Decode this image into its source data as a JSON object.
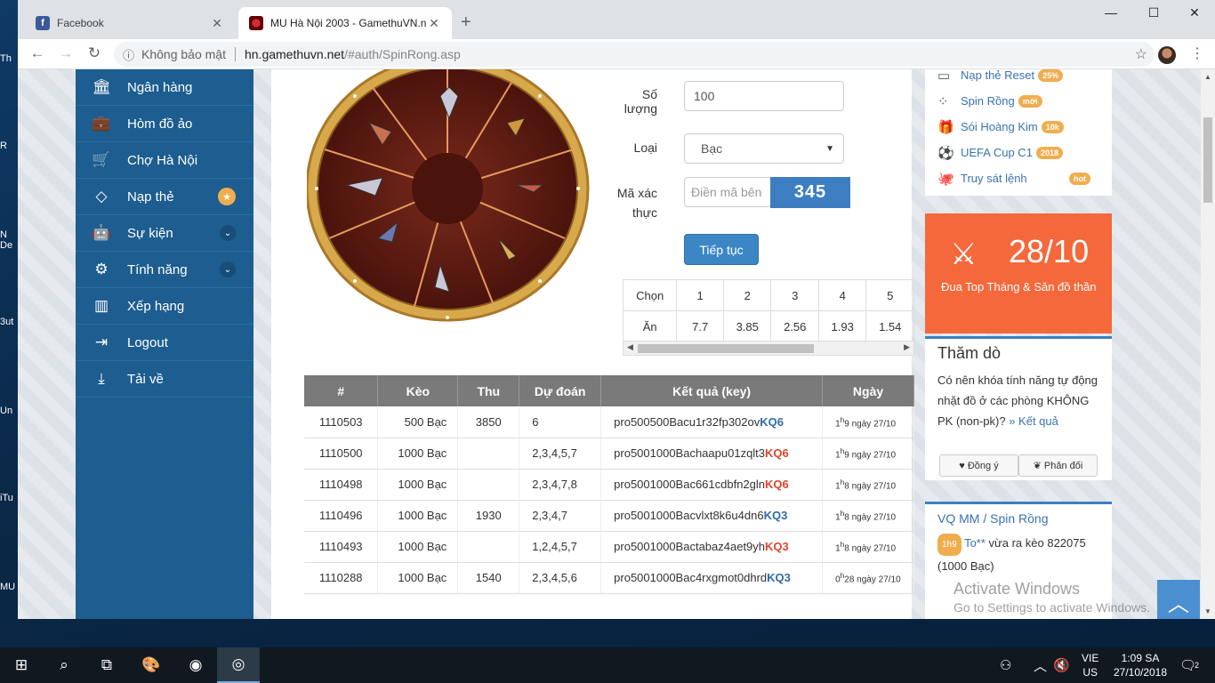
{
  "desktop": {
    "icons": [
      "Th",
      "R",
      "N\nDe",
      "3ut",
      "Un",
      "iTu",
      "MU"
    ]
  },
  "browser": {
    "tabs": [
      {
        "title": "Facebook",
        "active": false
      },
      {
        "title": "MU Hà Nội 2003 - GamethuVN.n",
        "active": true
      }
    ],
    "window_controls": {
      "minimize": "—",
      "maximize": "☐",
      "close": "✕"
    },
    "address": {
      "security_label": "Không bảo mật",
      "host": "hn.gamethuvn.net",
      "path": "/#auth/SpinRong.asp"
    }
  },
  "sidebar": {
    "items": [
      {
        "label": "Ngân hàng",
        "icon": "bank-icon"
      },
      {
        "label": "Hòm đồ ảo",
        "icon": "briefcase-icon"
      },
      {
        "label": "Chợ Hà Nội",
        "icon": "cart-icon"
      },
      {
        "label": "Nạp thẻ",
        "icon": "diamond-icon"
      },
      {
        "label": "Sự kiện",
        "icon": "android-icon"
      },
      {
        "label": "Tính năng",
        "icon": "cogs-icon"
      },
      {
        "label": "Xếp hạng",
        "icon": "bar-chart-icon"
      },
      {
        "label": "Logout",
        "icon": "logout-icon"
      },
      {
        "label": "Tải về",
        "icon": "download-icon"
      }
    ]
  },
  "form": {
    "quantity_label": "Số lượng",
    "quantity_value": "100",
    "type_label": "Loại",
    "type_value": "Bạc",
    "captcha_label_1": "Mã xác",
    "captcha_label_2": "thực",
    "captcha_placeholder": "Điền mã bên",
    "captcha_code": "345",
    "submit_label": "Tiếp tục"
  },
  "odds": {
    "choose_label": "Chọn",
    "win_label": "Ăn",
    "choices": [
      "1",
      "2",
      "3",
      "4",
      "5"
    ],
    "payouts": [
      "7.7",
      "3.85",
      "2.56",
      "1.93",
      "1.54"
    ]
  },
  "results": {
    "headers": [
      "#",
      "Kèo",
      "Thu",
      "Dự đoán",
      "Kết quả (key)",
      "Ngày"
    ],
    "rows": [
      {
        "id": "1110503",
        "bet": "500 Bạc",
        "collect": "3850",
        "guess": "6",
        "key": "pro500500Bacu1r32fp302ov",
        "kq": "KQ6",
        "kq_red": false,
        "date_a": "1",
        "date_b": "h",
        "date_c": "9 ngày 27/10"
      },
      {
        "id": "1110500",
        "bet": "1000 Bạc",
        "collect": "",
        "guess": "2,3,4,5,7",
        "key": "pro5001000Bachaapu01zqlt3",
        "kq": "KQ6",
        "kq_red": true,
        "date_a": "1",
        "date_b": "h",
        "date_c": "9 ngày 27/10"
      },
      {
        "id": "1110498",
        "bet": "1000 Bạc",
        "collect": "",
        "guess": "2,3,4,7,8",
        "key": "pro5001000Bac661cdbfn2gln",
        "kq": "KQ6",
        "kq_red": true,
        "date_a": "1",
        "date_b": "h",
        "date_c": "8 ngày 27/10"
      },
      {
        "id": "1110496",
        "bet": "1000 Bạc",
        "collect": "1930",
        "guess": "2,3,4,7",
        "key": "pro5001000Bacvlxt8k6u4dn6",
        "kq": "KQ3",
        "kq_red": false,
        "date_a": "1",
        "date_b": "h",
        "date_c": "8 ngày 27/10"
      },
      {
        "id": "1110493",
        "bet": "1000 Bạc",
        "collect": "",
        "guess": "1,2,4,5,7",
        "key": "pro5001000Bactabaz4aet9yh",
        "kq": "KQ3",
        "kq_red": true,
        "date_a": "1",
        "date_b": "h",
        "date_c": "8 ngày 27/10"
      },
      {
        "id": "1110288",
        "bet": "1000 Bạc",
        "collect": "1540",
        "guess": "2,3,4,5,6",
        "key": "pro5001000Bac4rxgmot0dhrd",
        "kq": "KQ3",
        "kq_red": false,
        "date_a": "0",
        "date_b": "h",
        "date_c": "28 ngày 27/10"
      }
    ]
  },
  "right": {
    "links": [
      {
        "label": "Nạp thẻ Reset",
        "badge": "25%",
        "badge_color": "#f0ad4e"
      },
      {
        "label": "Spin Rồng",
        "badge": "mới",
        "badge_color": "#f0ad4e"
      },
      {
        "label": "Sói Hoàng Kim",
        "badge": "10k",
        "badge_color": "#f0ad4e"
      },
      {
        "label": "UEFA Cup C1",
        "badge": "2018",
        "badge_color": "#f0ad4e"
      },
      {
        "label": "Truy sát lệnh",
        "badge": "hot",
        "badge_color": "#f0ad4e"
      }
    ],
    "promo": {
      "date": "28/10",
      "title": "Đua Top Tháng & Săn đồ thần"
    },
    "poll": {
      "title": "Thăm dò",
      "question": "Có nên khóa tính năng tự động nhặt đồ ở các phòng KHÔNG PK (non-pk)?",
      "result_link": "» Kết quả",
      "agree": "Đồng ý",
      "disagree": "Phản đối"
    },
    "vq": {
      "title_a": "VQ MM",
      "title_sep": " / ",
      "title_b": "Spin Rồng",
      "time_badge": "1h9",
      "user": "To**",
      "text": " vừa ra kèo 822075",
      "amount": "(1000 Bạc)"
    }
  },
  "watermark": {
    "line1": "Activate Windows",
    "line2": "Go to Settings to activate Windows."
  },
  "taskbar": {
    "lang_1": "VIE",
    "lang_2": "US",
    "time": "1:09 SA",
    "date": "27/10/2018",
    "notif_count": "2"
  }
}
